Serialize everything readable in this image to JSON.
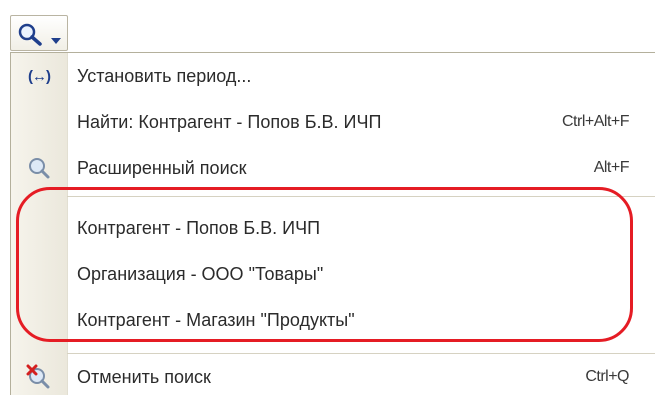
{
  "search_button": {
    "icon": "magnifier-icon",
    "arrow": "dropdown-arrow-icon"
  },
  "menu": {
    "items": [
      {
        "label": "Установить период...",
        "icon": "period-arrows-icon",
        "shortcut": ""
      },
      {
        "label": "Найти: Контрагент - Попов Б.В. ИЧП",
        "icon": "",
        "shortcut": "Ctrl+Alt+F"
      },
      {
        "label": "Расширенный поиск",
        "icon": "magnifier-icon",
        "shortcut": "Alt+F"
      },
      {
        "label": "Контрагент - Попов Б.В. ИЧП",
        "icon": "",
        "shortcut": ""
      },
      {
        "label": "Организация - ООО \"Товары\"",
        "icon": "",
        "shortcut": ""
      },
      {
        "label": "Контрагент - Магазин \"Продукты\"",
        "icon": "",
        "shortcut": ""
      },
      {
        "label": "Отменить поиск",
        "icon": "cancel-search-icon",
        "shortcut": "Ctrl+Q"
      }
    ]
  },
  "colors": {
    "highlight_ring": "#e51c24",
    "gutter": "#f2f0e6",
    "icon_blue": "#1f3f8c"
  }
}
